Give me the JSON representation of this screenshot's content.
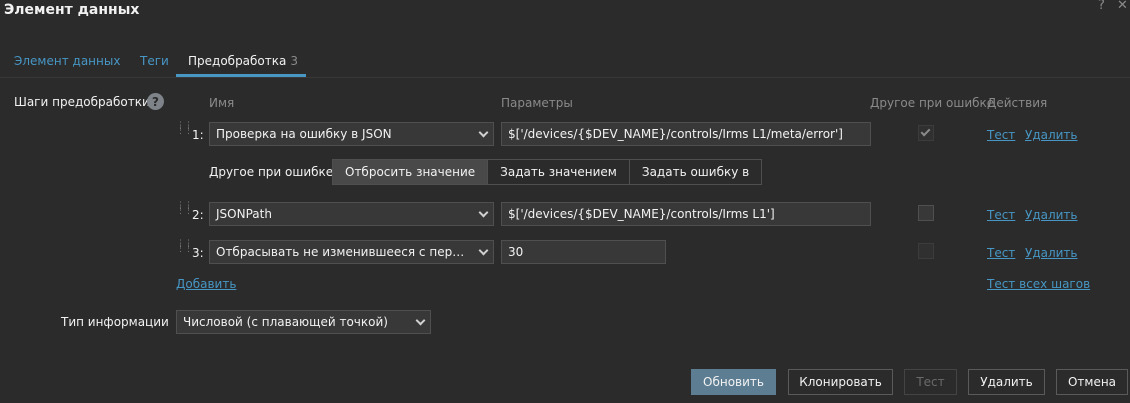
{
  "dialog": {
    "title": "Элемент данных",
    "help_glyph": "?",
    "close_glyph": "✕"
  },
  "tabs": [
    {
      "label": "Элемент данных"
    },
    {
      "label": "Теги"
    },
    {
      "label": "Предобработка",
      "count": "3"
    }
  ],
  "preproc": {
    "section_label": "Шаги предобработки",
    "help_glyph": "?",
    "columns": {
      "name": "Имя",
      "params": "Параметры",
      "on_fail": "Другое при ошибке",
      "actions": "Действия"
    },
    "steps": [
      {
        "num": "1:",
        "name": "Проверка на ошибку в JSON",
        "param": "$['/devices/{$DEV_NAME}/controls/Irms L1/meta/error']",
        "on_fail_checked": true,
        "test": "Тест",
        "remove": "Удалить"
      },
      {
        "num": "2:",
        "name": "JSONPath",
        "param": "$['/devices/{$DEV_NAME}/controls/Irms L1']",
        "on_fail_checked": false,
        "test": "Тест",
        "remove": "Удалить"
      },
      {
        "num": "3:",
        "name": "Отбрасывать не изменившееся с перио…",
        "param": "30",
        "on_fail_checked": false,
        "test": "Тест",
        "remove": "Удалить"
      }
    ],
    "on_fail_label": "Другое при ошибке",
    "on_fail_options": [
      "Отбросить значение",
      "Задать значением",
      "Задать ошибку в"
    ],
    "on_fail_selected": "Отбросить значение",
    "add_link": "Добавить",
    "test_all_link": "Тест всех шагов"
  },
  "info_type": {
    "label": "Тип информации",
    "value": "Числовой (с плавающей точкой)"
  },
  "buttons": {
    "update": "Обновить",
    "clone": "Клонировать",
    "test": "Тест",
    "delete": "Удалить",
    "cancel": "Отмена"
  },
  "colors": {
    "background": "#2b2b2b",
    "link": "#4796c4",
    "primary_button": "#5d7e92"
  }
}
